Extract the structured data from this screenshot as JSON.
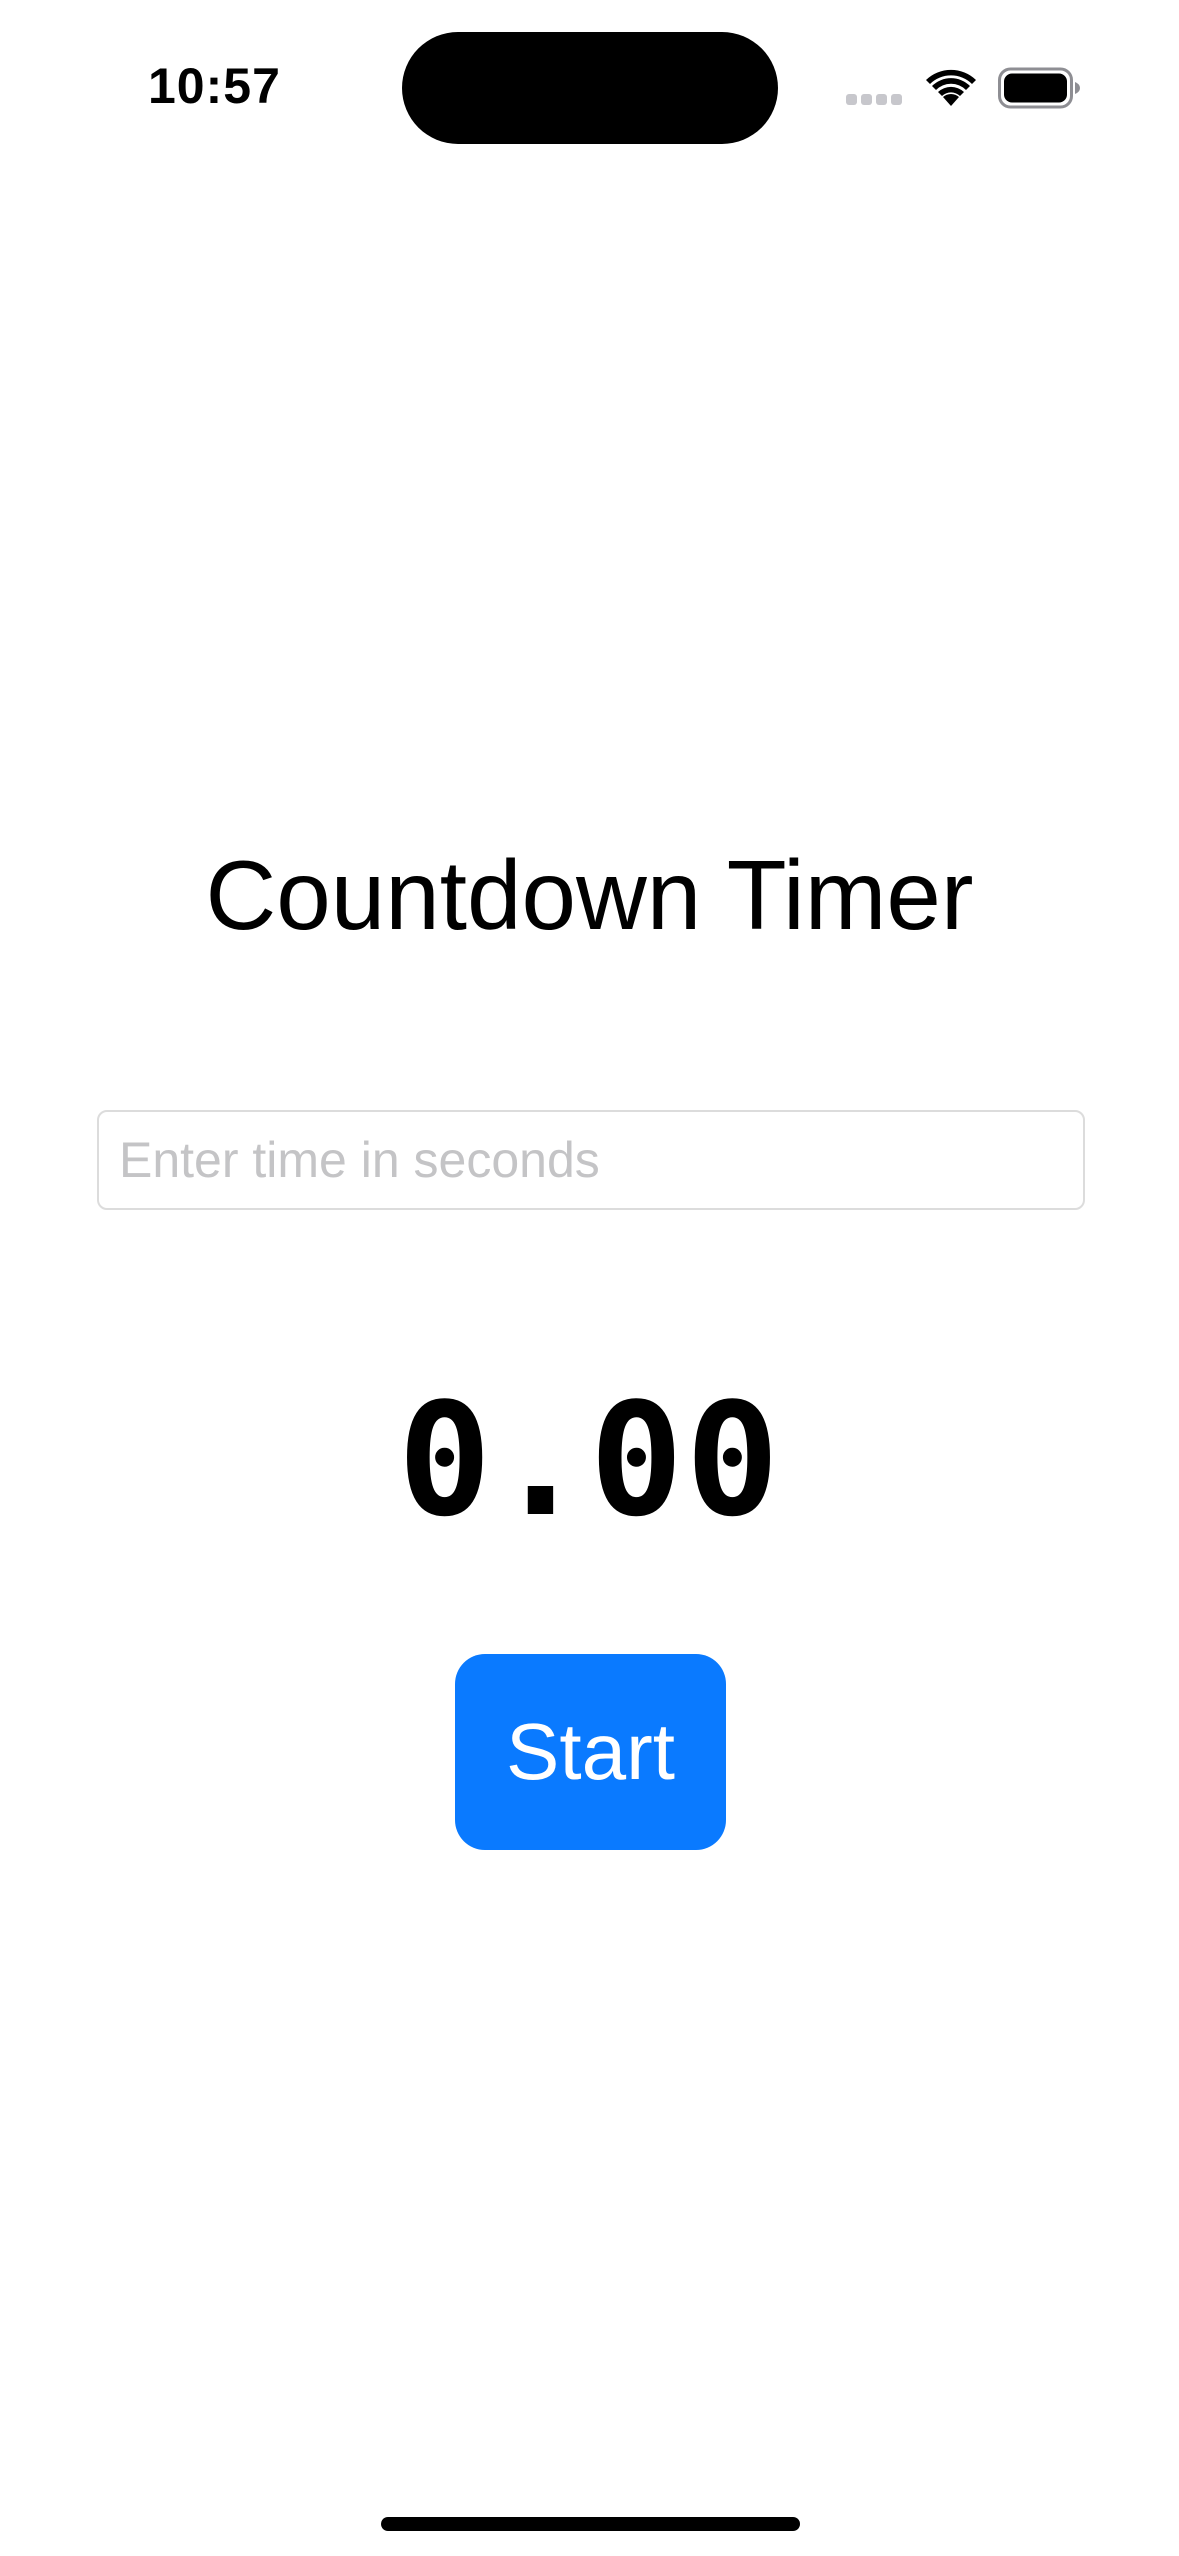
{
  "status_bar": {
    "time": "10:57",
    "icons": [
      "signal-icon",
      "wifi-icon",
      "battery-icon"
    ]
  },
  "app": {
    "title": "Countdown Timer",
    "input": {
      "placeholder": "Enter time in seconds",
      "value": ""
    },
    "timer_display": "0.00",
    "start_button_label": "Start"
  },
  "colors": {
    "accent": "#0A7AFF",
    "background": "#FFFFFF",
    "text": "#000000",
    "placeholder": "#C4C4C6",
    "input_border": "#DCDCDC"
  }
}
